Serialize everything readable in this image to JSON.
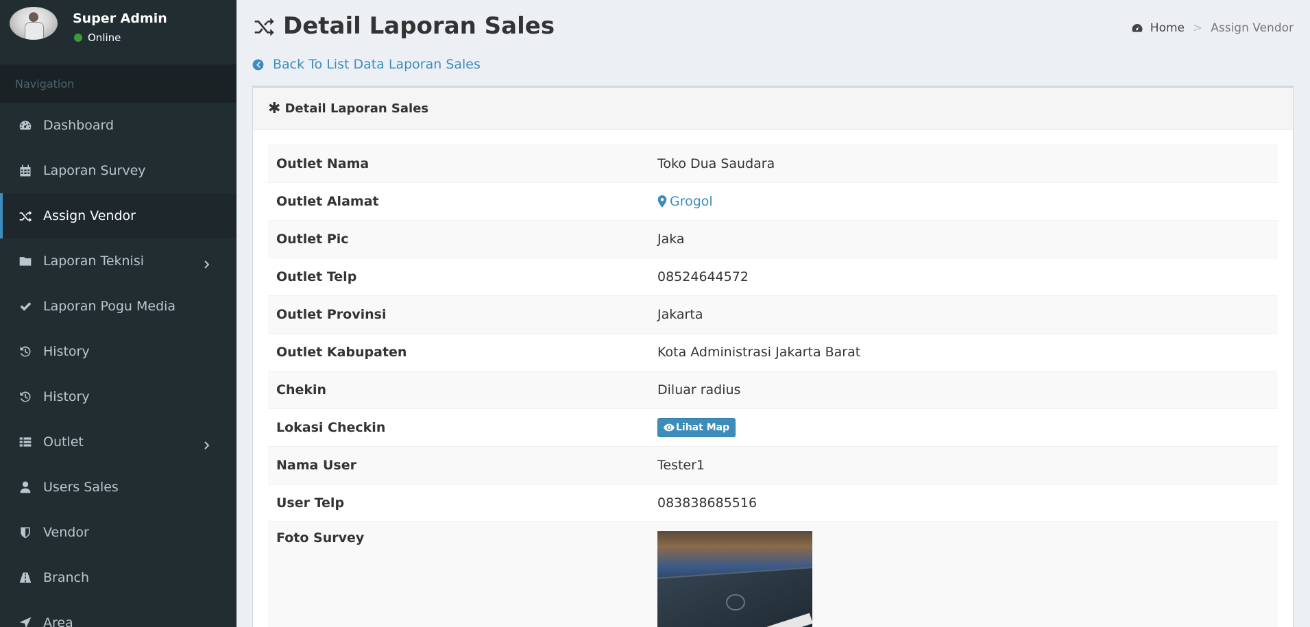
{
  "user": {
    "name": "Super Admin",
    "status": "Online"
  },
  "nav": {
    "header": "Navigation",
    "items": [
      {
        "label": "Dashboard",
        "icon": "dashboard-icon"
      },
      {
        "label": "Laporan Survey",
        "icon": "calendar-icon"
      },
      {
        "label": "Assign Vendor",
        "icon": "random-icon",
        "active": true
      },
      {
        "label": "Laporan Teknisi",
        "icon": "folder-icon",
        "submenu": true
      },
      {
        "label": "Laporan Pogu Media",
        "icon": "check-icon"
      },
      {
        "label": "History",
        "icon": "history-icon"
      },
      {
        "label": "History",
        "icon": "history-icon"
      },
      {
        "label": "Outlet",
        "icon": "list-icon",
        "submenu": true
      },
      {
        "label": "Users Sales",
        "icon": "user-icon"
      },
      {
        "label": "Vendor",
        "icon": "shield-icon"
      },
      {
        "label": "Branch",
        "icon": "road-icon"
      },
      {
        "label": "Area",
        "icon": "location-arrow-icon"
      }
    ]
  },
  "page": {
    "title": "Detail Laporan Sales",
    "back_link": "Back To List Data Laporan Sales",
    "breadcrumb": {
      "home": "Home",
      "current": "Assign Vendor"
    }
  },
  "box": {
    "title": "Detail Laporan Sales"
  },
  "details": {
    "outlet_nama": {
      "label": "Outlet Nama",
      "value": "Toko Dua Saudara"
    },
    "outlet_alamat": {
      "label": "Outlet Alamat",
      "value": "Grogol"
    },
    "outlet_pic": {
      "label": "Outlet Pic",
      "value": "Jaka"
    },
    "outlet_telp": {
      "label": "Outlet Telp",
      "value": "08524644572"
    },
    "outlet_provinsi": {
      "label": "Outlet Provinsi",
      "value": "Jakarta"
    },
    "outlet_kabupaten": {
      "label": "Outlet Kabupaten",
      "value": "Kota Administrasi Jakarta Barat"
    },
    "chekin": {
      "label": "Chekin",
      "value": "Diluar radius"
    },
    "lokasi_checkin": {
      "label": "Lokasi Checkin",
      "button": "Lihat Map"
    },
    "nama_user": {
      "label": "Nama User",
      "value": "Tester1"
    },
    "user_telp": {
      "label": "User Telp",
      "value": "083838685516"
    },
    "foto_survey": {
      "label": "Foto Survey"
    }
  },
  "colors": {
    "sidebar": "#222d32",
    "accent": "#3c8dbc",
    "background": "#ecf0f5"
  }
}
